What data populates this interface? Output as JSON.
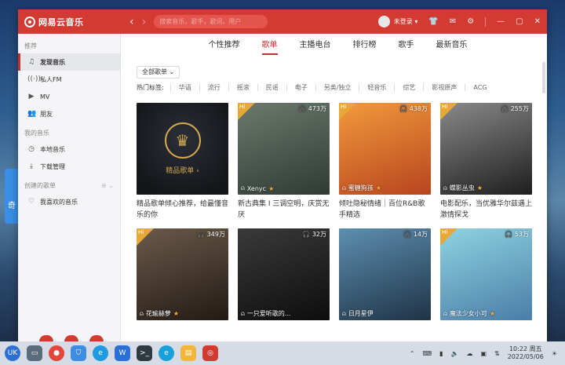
{
  "desktop": {
    "widget_text": "奇"
  },
  "titlebar": {
    "logo_text": "网易云音乐",
    "search_placeholder": "搜索音乐，歌手，歌词，用户",
    "user_label": "未登录 ▾",
    "icons": [
      "shirt-icon",
      "mail-icon",
      "gear-icon",
      "minimize-icon",
      "maximize-icon",
      "close-icon"
    ]
  },
  "sidebar": {
    "group_recommend": "推荐",
    "items_recommend": [
      {
        "label": "发现音乐",
        "icon": "music-note-icon",
        "active": true
      },
      {
        "label": "私人FM",
        "icon": "radio-icon"
      },
      {
        "label": "MV",
        "icon": "video-icon"
      },
      {
        "label": "朋友",
        "icon": "friends-icon"
      }
    ],
    "group_my_music": "我的音乐",
    "items_my_music": [
      {
        "label": "本地音乐",
        "icon": "clock-icon"
      },
      {
        "label": "下载管理",
        "icon": "download-icon"
      }
    ],
    "group_created": "创建的歌单",
    "items_created": [
      {
        "label": "我喜欢的音乐",
        "icon": "heart-icon"
      }
    ]
  },
  "tabs": [
    "个性推荐",
    "歌单",
    "主播电台",
    "排行榜",
    "歌手",
    "最新音乐"
  ],
  "active_tab": "歌单",
  "filter": {
    "label": "全部歌单 ⌄"
  },
  "hot_tags": {
    "label": "热门标签:",
    "tags": [
      "华语",
      "流行",
      "摇滚",
      "民谣",
      "电子",
      "另类/独立",
      "轻音乐",
      "综艺",
      "影视原声",
      "ACG"
    ]
  },
  "playlists": [
    {
      "premium": true,
      "premium_label": "精品歌单 ›",
      "title": "精品歌单倾心推荐，给最懂音乐的你"
    },
    {
      "play_count": "473万",
      "creator": "Xenyc",
      "title": "新古典集 I 三调空明，庆赏无厌",
      "colors": [
        "#6b7a6e",
        "#2f3a33"
      ]
    },
    {
      "play_count": "438万",
      "creator": "蜜糖狗孩",
      "title": "倾吐隐秘情绪｜百位R&B歌手精选",
      "colors": [
        "#f29a3c",
        "#b8441e"
      ]
    },
    {
      "play_count": "255万",
      "creator": "蝶影丛虫",
      "title": "电影配乐，当优雅华尔兹遇上激情探戈",
      "colors": [
        "#8a8a8a",
        "#1e1e1e"
      ]
    },
    {
      "play_count": "349万",
      "creator": "花瑜赫萝",
      "title": "",
      "colors": [
        "#6a5a4a",
        "#231a14"
      ]
    },
    {
      "play_count": "32万",
      "creator": "一只爱听歌的...",
      "title": "",
      "colors": [
        "#3a3a3a",
        "#0d0d0d"
      ]
    },
    {
      "play_count": "14万",
      "creator": "日月星伊",
      "title": "",
      "colors": [
        "#5d8fb0",
        "#1f3346"
      ]
    },
    {
      "play_count": "53万",
      "creator": "魔法少女小可",
      "title": "",
      "colors": [
        "#8fd3e0",
        "#4a7da8"
      ]
    }
  ],
  "taskbar": {
    "apps": [
      "start-icon",
      "files-icon",
      "record-icon",
      "store-icon",
      "browser-icon",
      "writer-icon",
      "terminal-icon",
      "edge-icon",
      "folder-icon",
      "netease-music-icon"
    ],
    "time": "10:22 周五",
    "date": "2022/05/06"
  }
}
